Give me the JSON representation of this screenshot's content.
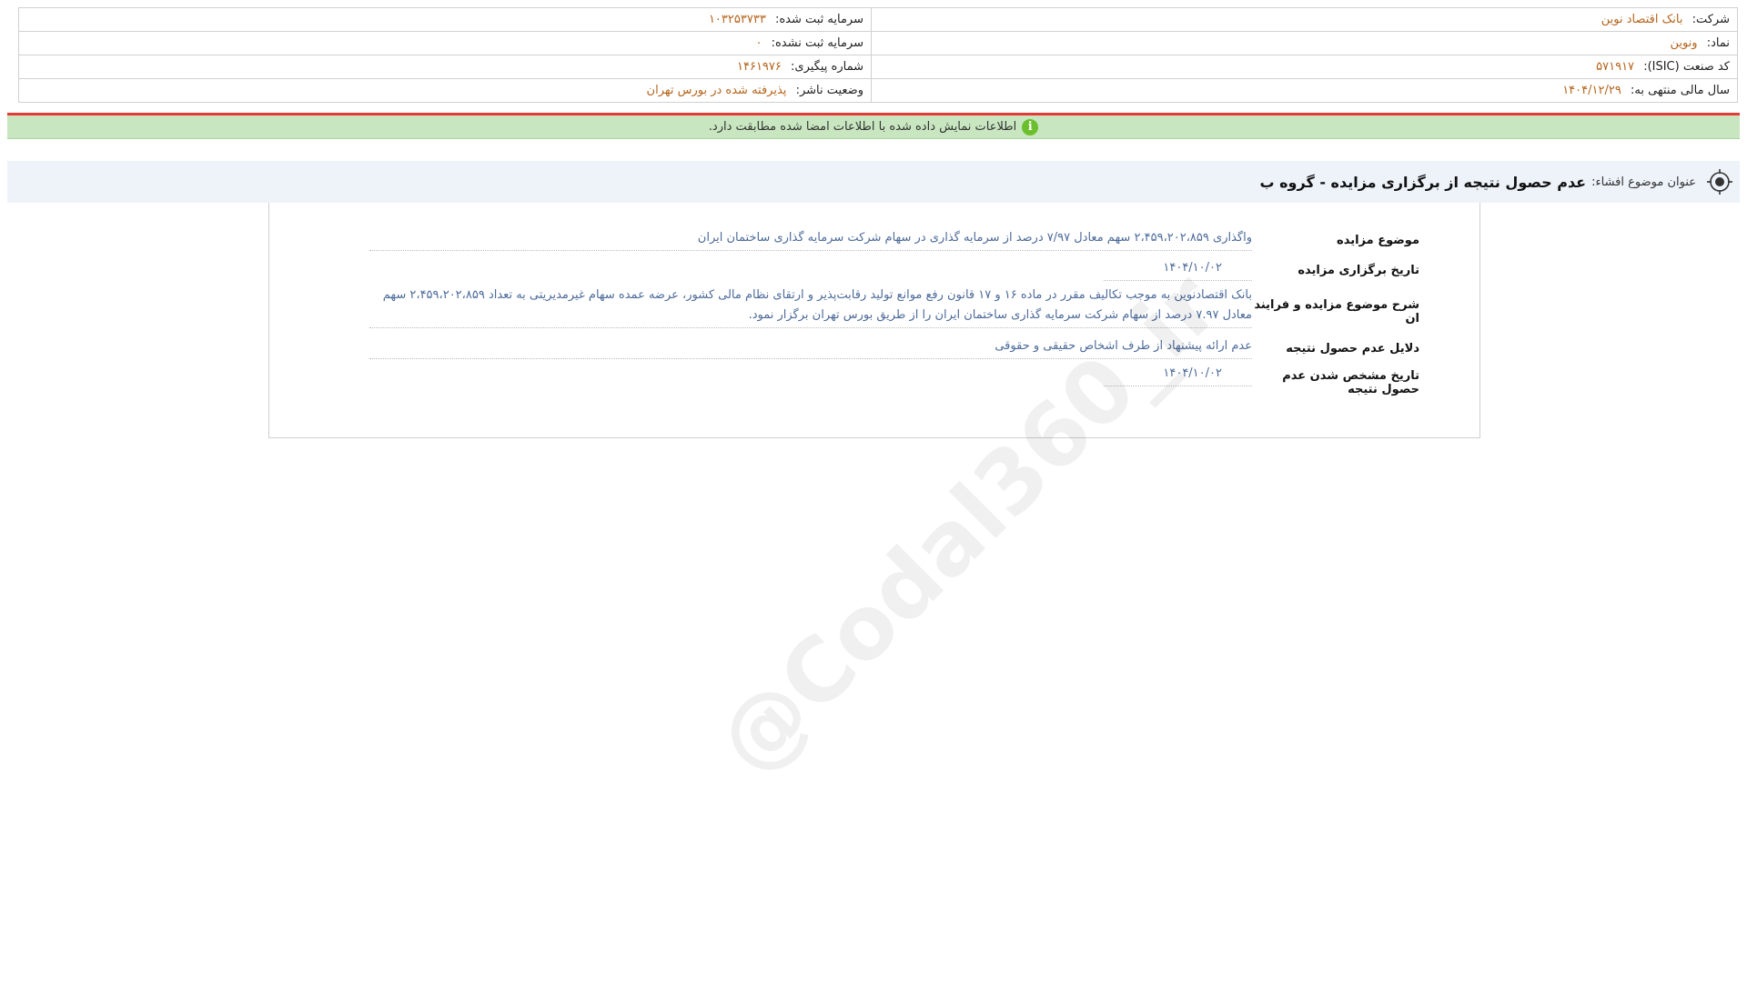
{
  "header": {
    "company_label": "شرکت:",
    "company_value": "بانک اقتصاد نوین",
    "registered_capital_label": "سرمایه ثبت شده:",
    "registered_capital_value": "۱۰۳۲۵۳۷۳۳",
    "symbol_label": "نماد:",
    "symbol_value": "ونوین",
    "unregistered_capital_label": "سرمایه ثبت نشده:",
    "unregistered_capital_value": "۰",
    "isic_label": "کد صنعت (ISIC):",
    "isic_value": "۵۷۱۹۱۷",
    "tracking_label": "شماره پیگیری:",
    "tracking_value": "۱۴۶۱۹۷۶",
    "fiscal_label": "سال مالی منتهی به:",
    "fiscal_value": "۱۴۰۴/۱۲/۲۹",
    "publisher_status_label": "وضعیت ناشر:",
    "publisher_status_value": "پذیرفته شده در بورس تهران"
  },
  "status_bar": {
    "icon": "info-icon",
    "text": "اطلاعات نمایش داده شده با اطلاعات امضا شده مطابقت دارد."
  },
  "title_bar": {
    "icon": "target-icon",
    "label": "عنوان موضوع افشاء:",
    "title": "عدم حصول نتیجه از برگزاری مزایده - گروه ب"
  },
  "details": {
    "subject_label": "موضوع مزایده",
    "subject_value": "واگذاری ۲،۴۵۹،۲۰۲،۸۵۹ سهم معادل ۷/۹۷ درصد از سرمایه گذاری در سهام شرکت سرمایه گذاری ساختمان ایران",
    "date_label": "تاریخ برگزاری مزایده",
    "date_value": "۱۴۰۴/۱۰/۰۲",
    "description_label": "شرح موضوع مزایده و فرایند ان",
    "description_value": "بانک اقتصادنوین به موجب تکالیف مقرر در ماده ۱۶ و ۱۷ قانون رفع موانع تولید رقابت‌پذیر و ارتقای نظام مالی کشور، عرضه عمده سهام غیرمدیریتی به تعداد ۲،۴۵۹،۲۰۲،۸۵۹ سهم معادل ۷.۹۷ درصد از سهام شرکت سرمایه گذاری ساختمان ایران را از طریق بورس تهران برگزار نمود.",
    "reasons_label": "دلایل عدم حصول نتیجه",
    "reasons_value": "عدم ارائه پیشنهاد از طرف اشخاص حقیقی و حقوقی",
    "result_date_label": "تاریخ مشخص شدن عدم حصول نتیجه",
    "result_date_value": "۱۴۰۴/۱۰/۰۲"
  },
  "watermark": "@Codal360_ir",
  "colors": {
    "value_orange": "#b5651d",
    "value_blue": "#4d6b9a",
    "status_green": "#c8e6c0",
    "alert_red": "#e53935"
  }
}
